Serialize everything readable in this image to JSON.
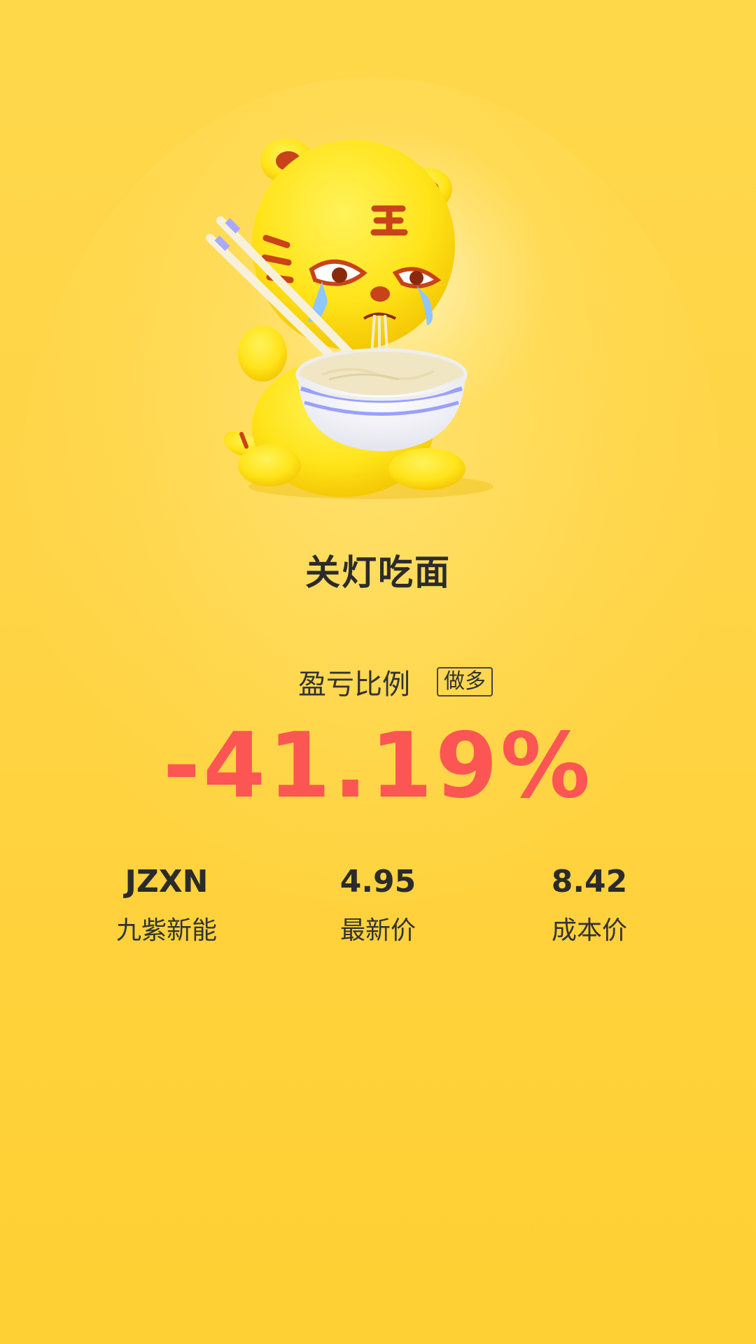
{
  "card": {
    "title": "关灯吃面",
    "mascot_icon": "tiger-crying-eating-noodles-illustration",
    "colors": {
      "background": "#ffd447",
      "loss": "#fb5653",
      "text": "#2b2b2b"
    }
  },
  "ratio": {
    "label": "盈亏比例",
    "position_tag": "做多",
    "value": "-41.19%"
  },
  "stats": [
    {
      "value": "JZXN",
      "label": "九紫新能"
    },
    {
      "value": "4.95",
      "label": "最新价"
    },
    {
      "value": "8.42",
      "label": "成本价"
    }
  ]
}
